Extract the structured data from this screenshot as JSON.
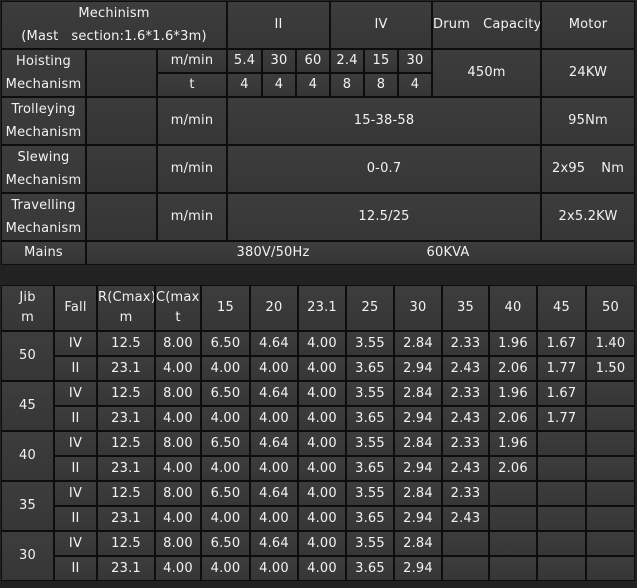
{
  "spec": {
    "mechanism_header_line1": "Mechinism",
    "mechanism_header_line2": "(Mast   section:1.6*1.6*3m)",
    "col_ii": "II",
    "col_iv": "IV",
    "drum_capacity": "Drum   Capacity",
    "motor": "Motor",
    "hoisting": {
      "line1": "Hoisting",
      "line2": "Mechanism",
      "unit_speed": "m/min",
      "unit_load": "t",
      "speeds_ii": [
        "5.4",
        "30",
        "60"
      ],
      "speeds_iv": [
        "2.4",
        "15",
        "30"
      ],
      "loads_ii": [
        "4",
        "4",
        "4"
      ],
      "loads_iv": [
        "8",
        "8",
        "4"
      ],
      "drum": "450m",
      "motor": "24KW"
    },
    "trolleying": {
      "line1": "Trolleying",
      "line2": "Mechanism",
      "unit": "m/min",
      "value": "15-38-58",
      "motor": "95Nm"
    },
    "slewing": {
      "line1": "Slewing",
      "line2": "Mechanism",
      "unit": "m/min",
      "value": "0-0.7",
      "motor_a": "2x95",
      "motor_b": "Nm"
    },
    "travelling": {
      "line1": "Travelling",
      "line2": "Mechanism",
      "unit": "m/min",
      "value": "12.5/25",
      "motor": "2x5.2KW"
    },
    "mains": {
      "label": "Mains",
      "voltage": "380V/50Hz",
      "power": "60KVA"
    }
  },
  "load_table": {
    "header": {
      "jib_line1": "Jib",
      "jib_line2": "m",
      "fall": "Fall",
      "r_line1": "R(Cmax)",
      "r_line2": "m",
      "c_line1": "C(max)",
      "c_line2": "t",
      "radii": [
        "15",
        "20",
        "23.1",
        "25",
        "30",
        "35",
        "40",
        "45",
        "50"
      ]
    },
    "groups": [
      {
        "jib": "50",
        "rows": [
          {
            "fall": "IV",
            "r": "12.5",
            "c": "8.00",
            "values": [
              "6.50",
              "4.64",
              "4.00",
              "3.55",
              "2.84",
              "2.33",
              "1.96",
              "1.67",
              "1.40"
            ]
          },
          {
            "fall": "II",
            "r": "23.1",
            "c": "4.00",
            "values": [
              "4.00",
              "4.00",
              "4.00",
              "3.65",
              "2.94",
              "2.43",
              "2.06",
              "1.77",
              "1.50"
            ]
          }
        ]
      },
      {
        "jib": "45",
        "rows": [
          {
            "fall": "IV",
            "r": "12.5",
            "c": "8.00",
            "values": [
              "6.50",
              "4.64",
              "4.00",
              "3.55",
              "2.84",
              "2.33",
              "1.96",
              "1.67",
              ""
            ]
          },
          {
            "fall": "II",
            "r": "23.1",
            "c": "4.00",
            "values": [
              "4.00",
              "4.00",
              "4.00",
              "3.65",
              "2.94",
              "2.43",
              "2.06",
              "1.77",
              ""
            ]
          }
        ]
      },
      {
        "jib": "40",
        "rows": [
          {
            "fall": "IV",
            "r": "12.5",
            "c": "8.00",
            "values": [
              "6.50",
              "4.64",
              "4.00",
              "3.55",
              "2.84",
              "2.33",
              "1.96",
              "",
              ""
            ]
          },
          {
            "fall": "II",
            "r": "23.1",
            "c": "4.00",
            "values": [
              "4.00",
              "4.00",
              "4.00",
              "3.65",
              "2.94",
              "2.43",
              "2.06",
              "",
              ""
            ]
          }
        ]
      },
      {
        "jib": "35",
        "rows": [
          {
            "fall": "IV",
            "r": "12.5",
            "c": "8.00",
            "values": [
              "6.50",
              "4.64",
              "4.00",
              "3.55",
              "2.84",
              "2.33",
              "",
              "",
              ""
            ]
          },
          {
            "fall": "II",
            "r": "23.1",
            "c": "4.00",
            "values": [
              "4.00",
              "4.00",
              "4.00",
              "3.65",
              "2.94",
              "2.43",
              "",
              "",
              ""
            ]
          }
        ]
      },
      {
        "jib": "30",
        "rows": [
          {
            "fall": "IV",
            "r": "12.5",
            "c": "8.00",
            "values": [
              "6.50",
              "4.64",
              "4.00",
              "3.55",
              "2.84",
              "",
              "",
              "",
              ""
            ]
          },
          {
            "fall": "II",
            "r": "23.1",
            "c": "4.00",
            "values": [
              "4.00",
              "4.00",
              "4.00",
              "3.65",
              "2.94",
              "",
              "",
              "",
              ""
            ]
          }
        ]
      }
    ]
  }
}
